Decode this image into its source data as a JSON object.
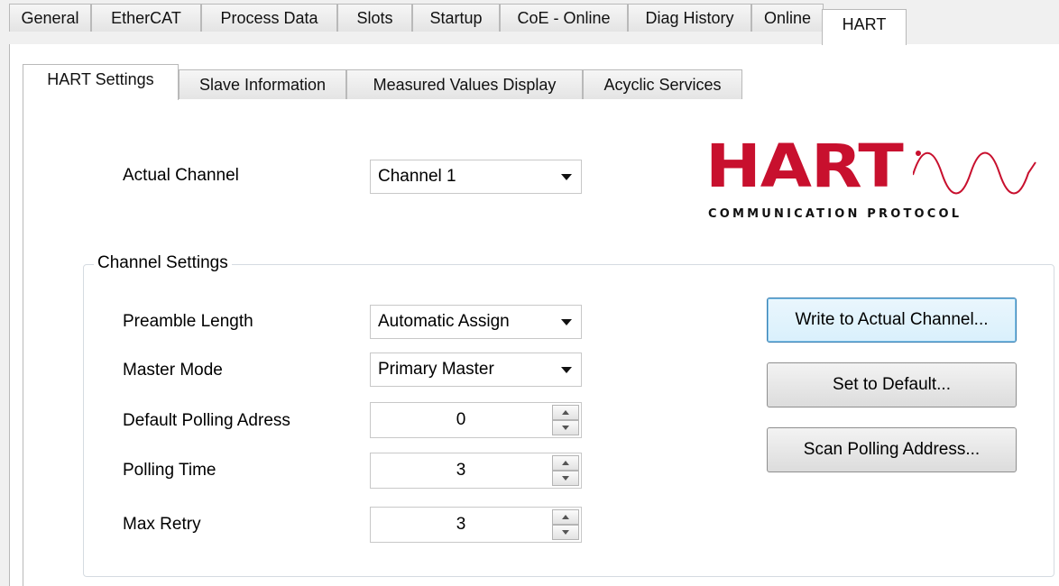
{
  "top_tabs": {
    "items": [
      {
        "label": "General"
      },
      {
        "label": "EtherCAT"
      },
      {
        "label": "Process Data"
      },
      {
        "label": "Slots"
      },
      {
        "label": "Startup"
      },
      {
        "label": "CoE - Online"
      },
      {
        "label": "Diag History"
      },
      {
        "label": "Online"
      },
      {
        "label": "HART"
      }
    ],
    "active": "HART"
  },
  "inner_tabs": {
    "items": [
      {
        "label": "HART Settings"
      },
      {
        "label": "Slave Information"
      },
      {
        "label": "Measured Values Display"
      },
      {
        "label": "Acyclic Services"
      }
    ],
    "active": "HART Settings"
  },
  "actual_channel": {
    "label": "Actual Channel",
    "value": "Channel 1"
  },
  "logo": {
    "word": "HART",
    "subtitle": "COMMUNICATION PROTOCOL",
    "color": "#c8102e"
  },
  "channel_settings": {
    "title": "Channel Settings",
    "preamble_length": {
      "label": "Preamble Length",
      "value": "Automatic Assign"
    },
    "master_mode": {
      "label": "Master Mode",
      "value": "Primary Master"
    },
    "default_polling_address": {
      "label": "Default Polling Adress",
      "value": "0"
    },
    "polling_time": {
      "label": "Polling Time",
      "value": "3"
    },
    "max_retry": {
      "label": "Max Retry",
      "value": "3"
    }
  },
  "buttons": {
    "write": "Write to Actual Channel...",
    "default": "Set to Default...",
    "scan": "Scan Polling Address..."
  },
  "icons": {
    "dropdown": "chevron-down-icon",
    "spin_up": "arrow-up-icon",
    "spin_down": "arrow-down-icon",
    "logo_wave": "sine-wave-icon"
  }
}
